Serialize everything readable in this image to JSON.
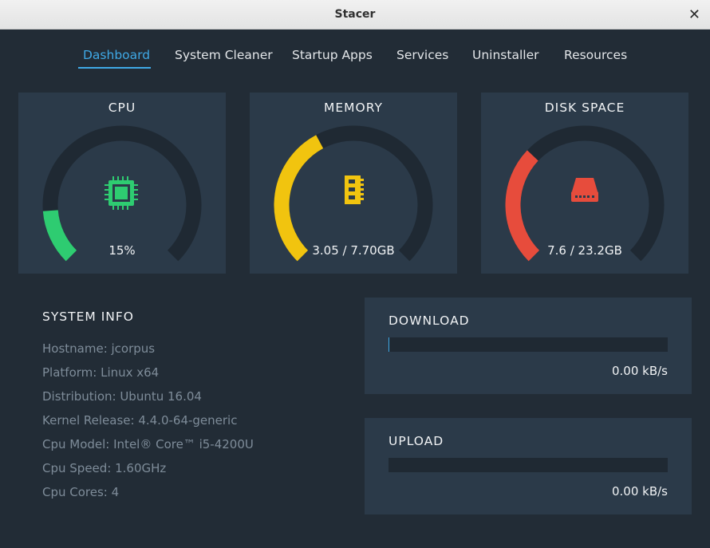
{
  "window": {
    "title": "Stacer",
    "close_glyph": "✕"
  },
  "tabs": [
    {
      "label": "Dashboard",
      "active": true
    },
    {
      "label": "System Cleaner",
      "active": false
    },
    {
      "label": "Startup Apps",
      "active": false
    },
    {
      "label": "Services",
      "active": false
    },
    {
      "label": "Uninstaller",
      "active": false
    },
    {
      "label": "Resources",
      "active": false
    }
  ],
  "gauges": {
    "cpu": {
      "title": "CPU",
      "value": "15%",
      "fraction": 0.15,
      "color": "#2ecc71",
      "icon": "cpu-chip-icon"
    },
    "memory": {
      "title": "MEMORY",
      "value": "3.05 / 7.70GB",
      "fraction": 0.396,
      "color": "#f1c40f",
      "icon": "memory-module-icon"
    },
    "disk": {
      "title": "DISK SPACE",
      "value": "7.6 / 23.2GB",
      "fraction": 0.328,
      "color": "#e74c3c",
      "icon": "hard-drive-icon"
    }
  },
  "track_color": "#1f2933",
  "system_info": {
    "title": "SYSTEM INFO",
    "lines": [
      "Hostname: jcorpus",
      "Platform: Linux x64",
      "Distribution: Ubuntu 16.04",
      "Kernel Release: 4.4.0-64-generic",
      "Cpu Model: Intel® Core™ i5-4200U",
      "Cpu Speed: 1.60GHz",
      "Cpu Cores: 4"
    ]
  },
  "network": {
    "download": {
      "title": "DOWNLOAD",
      "speed": "0.00 kB/s",
      "fraction": 0.003
    },
    "upload": {
      "title": "UPLOAD",
      "speed": "0.00 kB/s",
      "fraction": 0.0
    }
  },
  "accent_color": "#3fa9e6"
}
